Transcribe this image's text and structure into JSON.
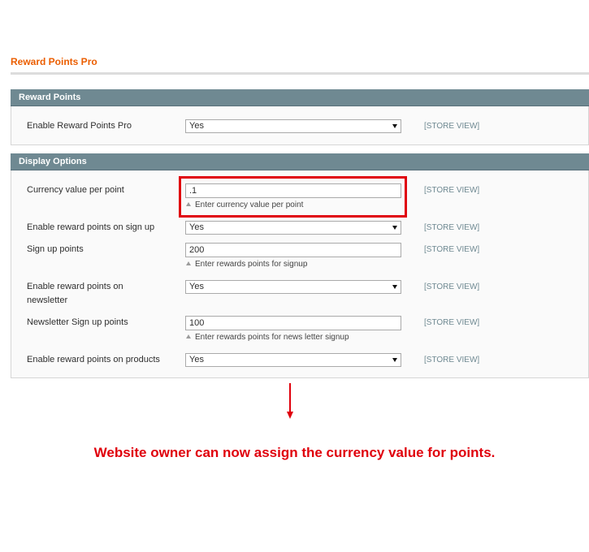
{
  "page": {
    "title": "Reward Points Pro"
  },
  "sections": {
    "reward_points": {
      "title": "Reward Points",
      "fields": {
        "enable": {
          "label": "Enable Reward Points Pro",
          "value": "Yes",
          "scope": "[STORE VIEW]"
        }
      }
    },
    "display_options": {
      "title": "Display Options",
      "fields": {
        "currency_value": {
          "label": "Currency value per point",
          "value": ".1",
          "note": "Enter currency value per point",
          "scope": "[STORE VIEW]"
        },
        "enable_signup": {
          "label": "Enable reward points on sign up",
          "value": "Yes",
          "scope": "[STORE VIEW]"
        },
        "signup_points": {
          "label": "Sign up points",
          "value": "200",
          "note": "Enter rewards points for signup",
          "scope": "[STORE VIEW]"
        },
        "enable_newsletter": {
          "label": "Enable reward points on newsletter",
          "value": "Yes",
          "scope": "[STORE VIEW]"
        },
        "newsletter_points": {
          "label": "Newsletter Sign up points",
          "value": "100",
          "note": "Enter rewards points for news letter signup",
          "scope": "[STORE VIEW]"
        },
        "enable_products": {
          "label": "Enable reward points on products",
          "value": "Yes",
          "scope": "[STORE VIEW]"
        }
      }
    }
  },
  "annotation": {
    "caption": "Website owner can now assign the currency value for points.",
    "color": "#e0000c"
  },
  "colors": {
    "title": "#eb5e00",
    "section_header": "#6f8992",
    "scope_text": "#6f8992"
  },
  "icons": {
    "select_arrow": "chevron-down-icon",
    "note_marker": "triangle-up-icon",
    "annotation_arrow": "arrow-down-icon"
  }
}
